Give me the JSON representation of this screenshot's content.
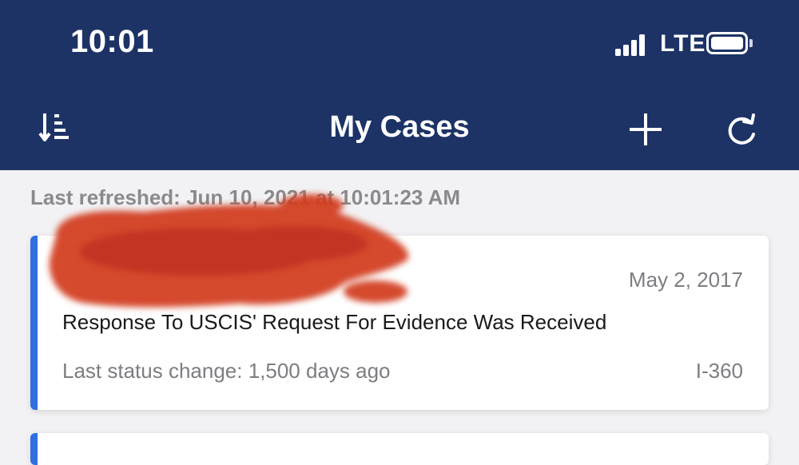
{
  "status_bar": {
    "time": "10:01",
    "network": "LTE",
    "icons": [
      "signal-icon",
      "battery-icon"
    ]
  },
  "nav": {
    "title": "My Cases",
    "icons": [
      "sort-icon",
      "add-icon",
      "refresh-icon"
    ]
  },
  "last_refreshed": "Last refreshed: Jun 10, 2021 at 10:01:23 AM",
  "cases": [
    {
      "date": "May 2, 2017",
      "status": "Response To USCIS' Request For Evidence Was Received",
      "last_change": "Last status change: 1,500 days ago",
      "form": "I-360"
    }
  ],
  "colors": {
    "header_bg": "#1d3366",
    "accent": "#2f6fe0",
    "redaction": "#d23a1e"
  }
}
